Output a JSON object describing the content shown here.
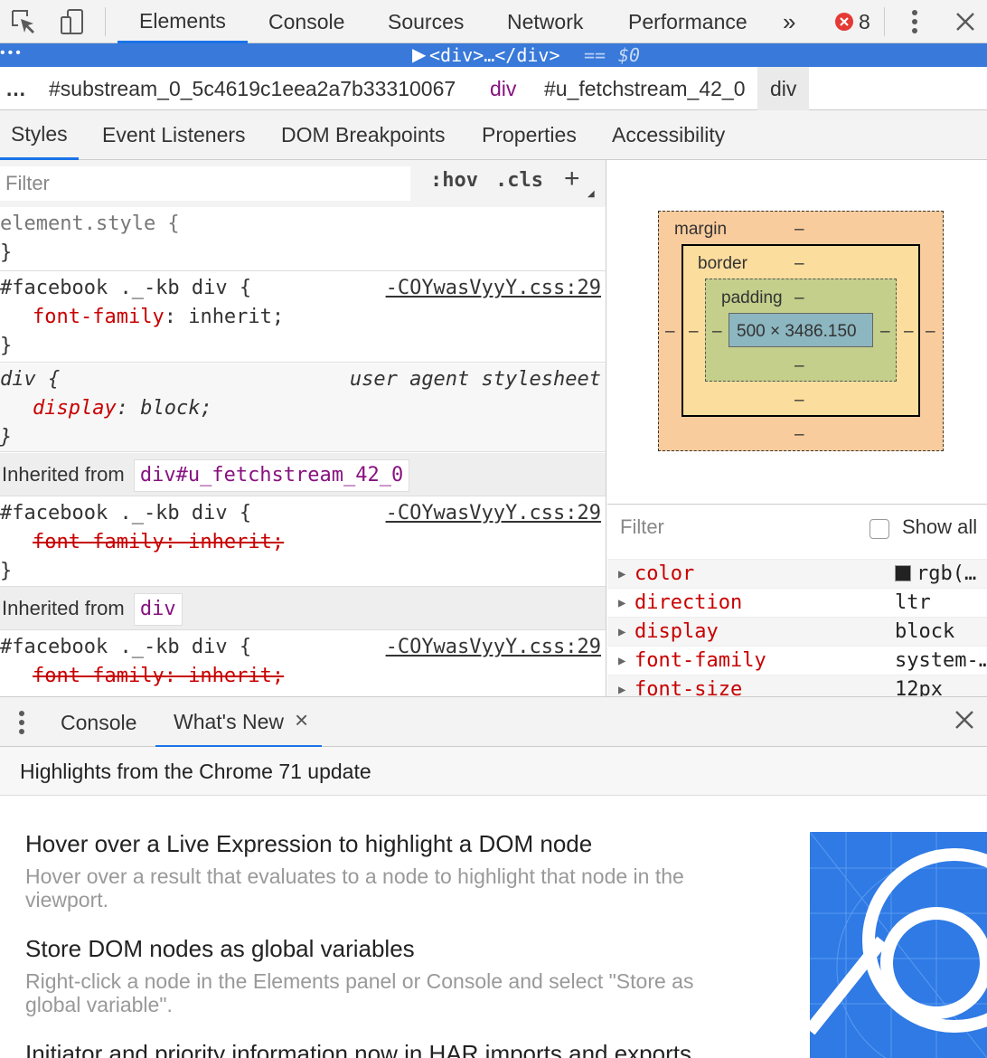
{
  "toolbar": {
    "tabs": [
      "Elements",
      "Console",
      "Sources",
      "Network",
      "Performance"
    ],
    "more": "»",
    "error_count": "8"
  },
  "dom_selection": {
    "text": "<div>…</div>",
    "eq": "==",
    "var": "$0"
  },
  "breadcrumb": {
    "ellipsis": "…",
    "items": [
      "#substream_0_5c4619c1eea2a7b33310067",
      "div",
      "#u_fetchstream_42_0",
      "div"
    ]
  },
  "subtabs": [
    "Styles",
    "Event Listeners",
    "DOM Breakpoints",
    "Properties",
    "Accessibility"
  ],
  "styles": {
    "filter_placeholder": "Filter",
    "hov": ":hov",
    "cls": ".cls",
    "add": "+",
    "element_style": {
      "selector": "element.style {",
      "close": "}"
    },
    "rule1": {
      "selector": "#facebook ._-kb div {",
      "source": "-COYwasVyyY.css:29",
      "prop": "font-family",
      "value": " inherit;",
      "close": "}"
    },
    "rule2": {
      "selector": "div {",
      "source": "user agent stylesheet",
      "prop": "display",
      "value": " block;",
      "close": "}"
    },
    "inherited1": {
      "label": "Inherited from",
      "node": "div#u_fetchstream_42_0"
    },
    "rule3": {
      "selector": "#facebook ._-kb div {",
      "source": "-COYwasVyyY.css:29",
      "prop": "font-family: inherit;",
      "close": "}"
    },
    "inherited2": {
      "label": "Inherited from",
      "node": "div"
    },
    "rule4": {
      "selector": "#facebook ._-kb div {",
      "source": "-COYwasVyyY.css:29",
      "prop": "font-family: inherit;"
    }
  },
  "box_model": {
    "margin_label": "margin",
    "border_label": "border",
    "padding_label": "padding",
    "content_size": "500 × 3486.150",
    "dash": "–"
  },
  "computed": {
    "filter_placeholder": "Filter",
    "show_all": "Show all",
    "props": [
      {
        "name": "color",
        "value": "rgb(…"
      },
      {
        "name": "direction",
        "value": "ltr"
      },
      {
        "name": "display",
        "value": "block"
      },
      {
        "name": "font-family",
        "value": "system-…"
      },
      {
        "name": "font-size",
        "value": "12px"
      }
    ]
  },
  "drawer": {
    "tabs": [
      "Console",
      "What's New"
    ],
    "close_tab": "×",
    "header": "Highlights from the Chrome 71 update",
    "items": [
      {
        "title": "Hover over a Live Expression to highlight a DOM node",
        "desc": "Hover over a result that evaluates to a node to highlight that node in the viewport."
      },
      {
        "title": "Store DOM nodes as global variables",
        "desc": "Right-click a node in the Elements panel or Console and select \"Store as global variable\"."
      },
      {
        "title": "Initiator and priority information now in HAR imports and exports"
      }
    ]
  },
  "colors": {
    "accent": "#1a73e8",
    "selection": "#3879d9",
    "property": "#c80000",
    "tag": "#881280",
    "margin": "#f9cc9d",
    "border": "#fbdd9d",
    "padding": "#c3cf8a",
    "content": "#8cb6c0",
    "error": "#e53935"
  }
}
